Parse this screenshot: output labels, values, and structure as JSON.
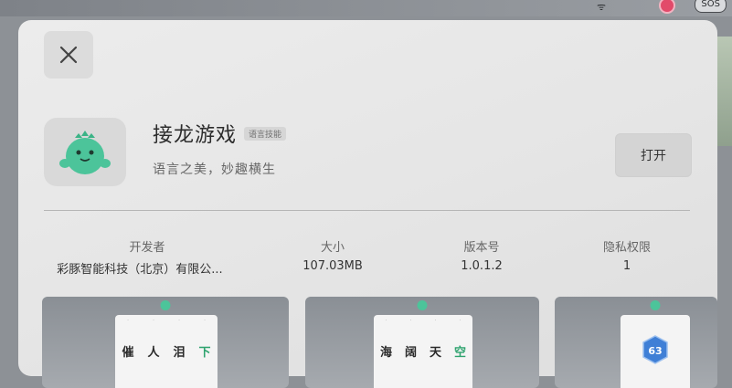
{
  "status_bar": {
    "sos": "SOS"
  },
  "app": {
    "title": "接龙游戏",
    "tag": "语言技能",
    "subtitle": "语言之美，妙趣横生",
    "open_label": "打开"
  },
  "info": [
    {
      "label": "开发者",
      "value": "彩豚智能科技（北京）有限公..."
    },
    {
      "label": "大小",
      "value": "107.03MB"
    },
    {
      "label": "版本号",
      "value": "1.0.1.2"
    },
    {
      "label": "隐私权限",
      "value": "1"
    }
  ],
  "screenshots": [
    {
      "chars": [
        "催",
        "人",
        "泪",
        "下"
      ]
    },
    {
      "chars": [
        "海",
        "阔",
        "天",
        "空"
      ]
    },
    {
      "badge": "63"
    }
  ],
  "colors": {
    "accent_green": "#2ea36e",
    "mascot_green": "#4cc49a"
  },
  "icons": [
    "close-icon",
    "wifi-icon",
    "record-icon",
    "dinosaur-mascot-icon"
  ]
}
